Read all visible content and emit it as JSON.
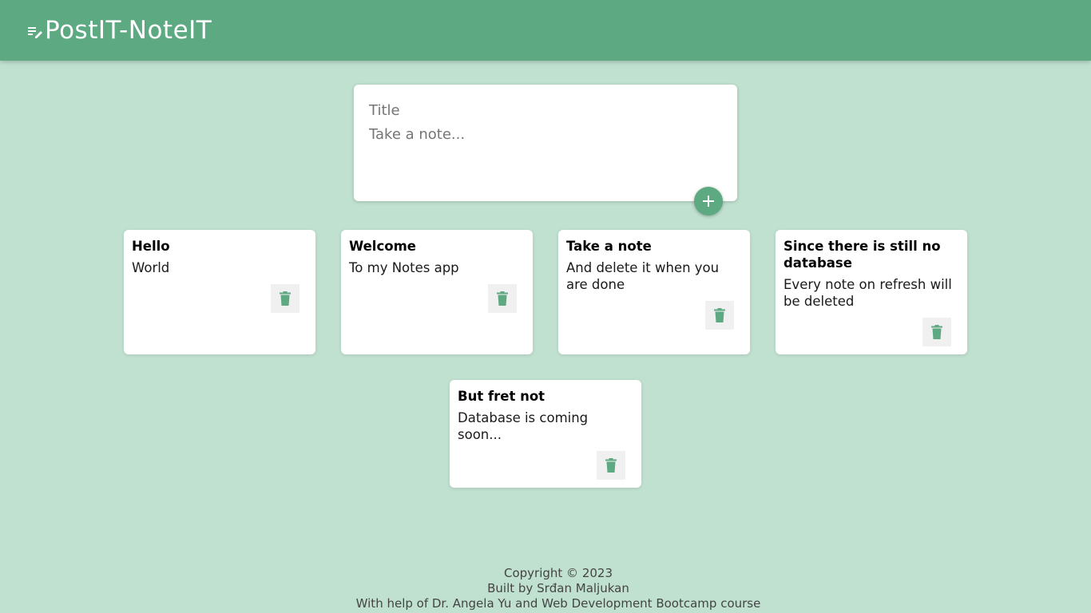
{
  "colors": {
    "header_bg": "#5ca982",
    "page_bg": "#c0e1d0",
    "accent": "#5ca982",
    "card_bg": "#ffffff"
  },
  "header": {
    "title": "PostIT-NoteIT",
    "icon": "notes-edit-icon"
  },
  "composer": {
    "title_placeholder": "Title",
    "note_placeholder": "Take a note...",
    "add_icon": "plus-icon"
  },
  "notes": [
    {
      "title": "Hello",
      "body": "World",
      "delete_icon": "trash-icon"
    },
    {
      "title": "Welcome",
      "body": "To my Notes app",
      "delete_icon": "trash-icon"
    },
    {
      "title": "Take a note",
      "body": "And delete it when you are done",
      "delete_icon": "trash-icon"
    },
    {
      "title": "Since there is still no database",
      "body": "Every note on refresh will be deleted",
      "delete_icon": "trash-icon"
    },
    {
      "title": "But fret not",
      "body": "Database is coming soon...",
      "delete_icon": "trash-icon"
    }
  ],
  "footer": {
    "copyright": "Copyright © 2023",
    "built_by": "Built by Srđan Maljukan",
    "credits": "With help of Dr. Angela Yu and Web Development Bootcamp course"
  }
}
